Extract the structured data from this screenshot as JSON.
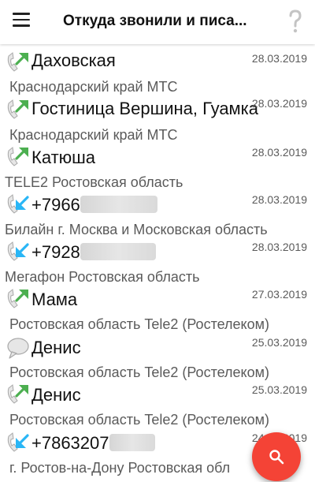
{
  "appbar": {
    "title": "Откуда звонили и писа...",
    "menu_icon": "hamburger-menu-icon",
    "help_icon": "question-mark-icon"
  },
  "colors": {
    "outgoing_arrow": "#4caf50",
    "incoming_arrow": "#29b6f6",
    "fab": "#f44336",
    "secondary_text": "#5a5a5a"
  },
  "entries": [
    {
      "type": "outgoing-call",
      "name": "Даховская",
      "date": "28.03.2019",
      "info": "Краснодарский край МТС"
    },
    {
      "type": "outgoing-call",
      "name": "Гостиница Вершина, Гуамка",
      "date": "28.03.2019",
      "info": "Краснодарский край МТС"
    },
    {
      "type": "outgoing-call",
      "name": "Катюша",
      "date": "28.03.2019",
      "info": "TELE2  Ростовская область"
    },
    {
      "type": "incoming-call",
      "name": "+7966",
      "date": "28.03.2019",
      "info": "Билайн  г. Москва и Московская область"
    },
    {
      "type": "incoming-call",
      "name": "+7928",
      "date": "28.03.2019",
      "info": "Мегафон  Ростовская область"
    },
    {
      "type": "outgoing-call",
      "name": "Мама",
      "date": "27.03.2019",
      "info": "Ростовская область Tele2 (Ростелеком)"
    },
    {
      "type": "message",
      "name": "Денис",
      "date": "25.03.2019",
      "info": "Ростовская область Tele2 (Ростелеком)"
    },
    {
      "type": "outgoing-call",
      "name": "Денис",
      "date": "25.03.2019",
      "info": "Ростовская область Tele2 (Ростелеком)"
    },
    {
      "type": "incoming-call",
      "name": "+7863207",
      "date": "24.03.2019",
      "info": "г. Ростов-на-Дону Ростовская обл"
    }
  ],
  "fab": {
    "icon": "search-icon"
  }
}
